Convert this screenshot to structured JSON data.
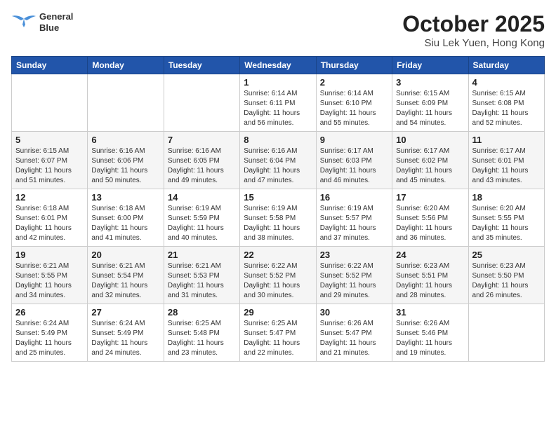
{
  "header": {
    "logo_line1": "General",
    "logo_line2": "Blue",
    "month_year": "October 2025",
    "location": "Siu Lek Yuen, Hong Kong"
  },
  "weekdays": [
    "Sunday",
    "Monday",
    "Tuesday",
    "Wednesday",
    "Thursday",
    "Friday",
    "Saturday"
  ],
  "weeks": [
    [
      {
        "day": "",
        "info": ""
      },
      {
        "day": "",
        "info": ""
      },
      {
        "day": "",
        "info": ""
      },
      {
        "day": "1",
        "info": "Sunrise: 6:14 AM\nSunset: 6:11 PM\nDaylight: 11 hours\nand 56 minutes."
      },
      {
        "day": "2",
        "info": "Sunrise: 6:14 AM\nSunset: 6:10 PM\nDaylight: 11 hours\nand 55 minutes."
      },
      {
        "day": "3",
        "info": "Sunrise: 6:15 AM\nSunset: 6:09 PM\nDaylight: 11 hours\nand 54 minutes."
      },
      {
        "day": "4",
        "info": "Sunrise: 6:15 AM\nSunset: 6:08 PM\nDaylight: 11 hours\nand 52 minutes."
      }
    ],
    [
      {
        "day": "5",
        "info": "Sunrise: 6:15 AM\nSunset: 6:07 PM\nDaylight: 11 hours\nand 51 minutes."
      },
      {
        "day": "6",
        "info": "Sunrise: 6:16 AM\nSunset: 6:06 PM\nDaylight: 11 hours\nand 50 minutes."
      },
      {
        "day": "7",
        "info": "Sunrise: 6:16 AM\nSunset: 6:05 PM\nDaylight: 11 hours\nand 49 minutes."
      },
      {
        "day": "8",
        "info": "Sunrise: 6:16 AM\nSunset: 6:04 PM\nDaylight: 11 hours\nand 47 minutes."
      },
      {
        "day": "9",
        "info": "Sunrise: 6:17 AM\nSunset: 6:03 PM\nDaylight: 11 hours\nand 46 minutes."
      },
      {
        "day": "10",
        "info": "Sunrise: 6:17 AM\nSunset: 6:02 PM\nDaylight: 11 hours\nand 45 minutes."
      },
      {
        "day": "11",
        "info": "Sunrise: 6:17 AM\nSunset: 6:01 PM\nDaylight: 11 hours\nand 43 minutes."
      }
    ],
    [
      {
        "day": "12",
        "info": "Sunrise: 6:18 AM\nSunset: 6:01 PM\nDaylight: 11 hours\nand 42 minutes."
      },
      {
        "day": "13",
        "info": "Sunrise: 6:18 AM\nSunset: 6:00 PM\nDaylight: 11 hours\nand 41 minutes."
      },
      {
        "day": "14",
        "info": "Sunrise: 6:19 AM\nSunset: 5:59 PM\nDaylight: 11 hours\nand 40 minutes."
      },
      {
        "day": "15",
        "info": "Sunrise: 6:19 AM\nSunset: 5:58 PM\nDaylight: 11 hours\nand 38 minutes."
      },
      {
        "day": "16",
        "info": "Sunrise: 6:19 AM\nSunset: 5:57 PM\nDaylight: 11 hours\nand 37 minutes."
      },
      {
        "day": "17",
        "info": "Sunrise: 6:20 AM\nSunset: 5:56 PM\nDaylight: 11 hours\nand 36 minutes."
      },
      {
        "day": "18",
        "info": "Sunrise: 6:20 AM\nSunset: 5:55 PM\nDaylight: 11 hours\nand 35 minutes."
      }
    ],
    [
      {
        "day": "19",
        "info": "Sunrise: 6:21 AM\nSunset: 5:55 PM\nDaylight: 11 hours\nand 34 minutes."
      },
      {
        "day": "20",
        "info": "Sunrise: 6:21 AM\nSunset: 5:54 PM\nDaylight: 11 hours\nand 32 minutes."
      },
      {
        "day": "21",
        "info": "Sunrise: 6:21 AM\nSunset: 5:53 PM\nDaylight: 11 hours\nand 31 minutes."
      },
      {
        "day": "22",
        "info": "Sunrise: 6:22 AM\nSunset: 5:52 PM\nDaylight: 11 hours\nand 30 minutes."
      },
      {
        "day": "23",
        "info": "Sunrise: 6:22 AM\nSunset: 5:52 PM\nDaylight: 11 hours\nand 29 minutes."
      },
      {
        "day": "24",
        "info": "Sunrise: 6:23 AM\nSunset: 5:51 PM\nDaylight: 11 hours\nand 28 minutes."
      },
      {
        "day": "25",
        "info": "Sunrise: 6:23 AM\nSunset: 5:50 PM\nDaylight: 11 hours\nand 26 minutes."
      }
    ],
    [
      {
        "day": "26",
        "info": "Sunrise: 6:24 AM\nSunset: 5:49 PM\nDaylight: 11 hours\nand 25 minutes."
      },
      {
        "day": "27",
        "info": "Sunrise: 6:24 AM\nSunset: 5:49 PM\nDaylight: 11 hours\nand 24 minutes."
      },
      {
        "day": "28",
        "info": "Sunrise: 6:25 AM\nSunset: 5:48 PM\nDaylight: 11 hours\nand 23 minutes."
      },
      {
        "day": "29",
        "info": "Sunrise: 6:25 AM\nSunset: 5:47 PM\nDaylight: 11 hours\nand 22 minutes."
      },
      {
        "day": "30",
        "info": "Sunrise: 6:26 AM\nSunset: 5:47 PM\nDaylight: 11 hours\nand 21 minutes."
      },
      {
        "day": "31",
        "info": "Sunrise: 6:26 AM\nSunset: 5:46 PM\nDaylight: 11 hours\nand 19 minutes."
      },
      {
        "day": "",
        "info": ""
      }
    ]
  ]
}
